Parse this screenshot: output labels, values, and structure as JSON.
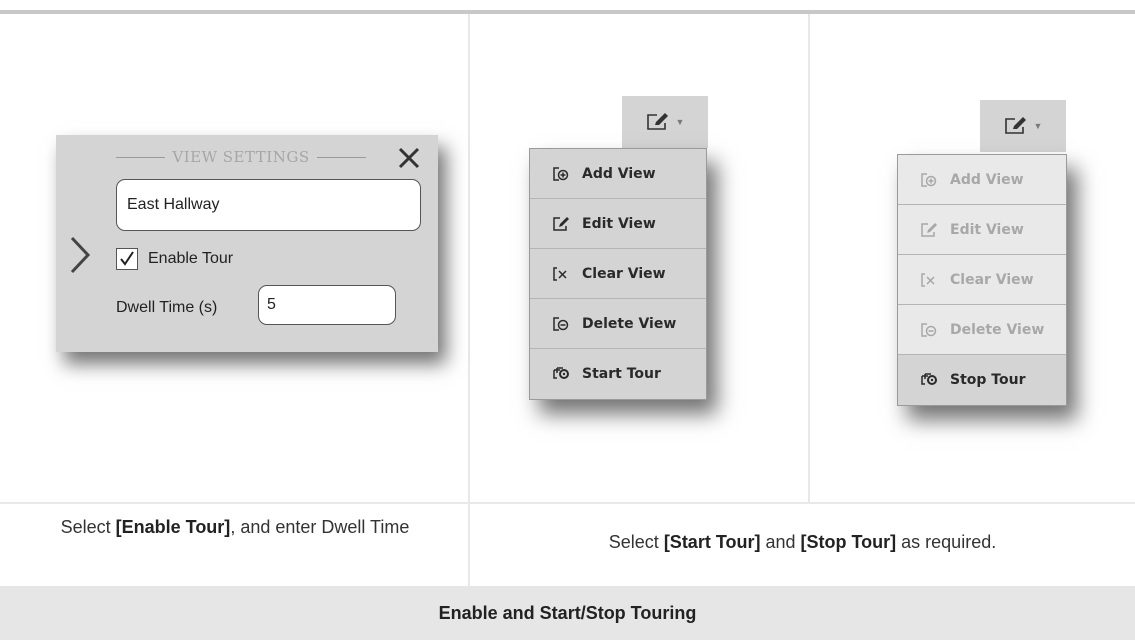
{
  "view_settings": {
    "title": "VIEW SETTINGS",
    "view_name_value": "East Hallway",
    "enable_tour_label": "Enable Tour",
    "enable_tour_checked": true,
    "dwell_label": "Dwell Time (s)",
    "dwell_value": "5",
    "icons": {
      "close": "close-icon",
      "expand": "chevron-right-icon",
      "check": "checkmark-icon"
    }
  },
  "menu_default": {
    "button_icon": "edit-view-icon",
    "items": [
      {
        "label": "Add View",
        "icon": "add-view-icon"
      },
      {
        "label": "Edit View",
        "icon": "edit-view-icon"
      },
      {
        "label": "Clear View",
        "icon": "clear-view-icon"
      },
      {
        "label": "Delete View",
        "icon": "delete-view-icon"
      },
      {
        "label": "Start Tour",
        "icon": "tour-icon"
      }
    ]
  },
  "menu_touring": {
    "button_icon": "edit-view-icon",
    "items": [
      {
        "label": "Add View",
        "icon": "add-view-icon",
        "enabled": false
      },
      {
        "label": "Edit View",
        "icon": "edit-view-icon",
        "enabled": false
      },
      {
        "label": "Clear View",
        "icon": "clear-view-icon",
        "enabled": false
      },
      {
        "label": "Delete View",
        "icon": "delete-view-icon",
        "enabled": false
      },
      {
        "label": "Stop Tour",
        "icon": "tour-icon",
        "enabled": true
      }
    ]
  },
  "captions": {
    "left_prefix": "Select ",
    "left_bold": "[Enable Tour]",
    "left_suffix": ", and enter Dwell Time",
    "right_prefix": "Select ",
    "right_bold_1": "[Start Tour]",
    "right_mid": " and ",
    "right_bold_2": "[Stop Tour]",
    "right_suffix": " as required."
  },
  "footer_title": "Enable and Start/Stop Touring",
  "colors": {
    "panel_gray": "#d4d4d4",
    "disabled_item": "#e9e9e9",
    "footer_bg": "#e6e6e6",
    "grid_lines": "#e8e8e8"
  }
}
